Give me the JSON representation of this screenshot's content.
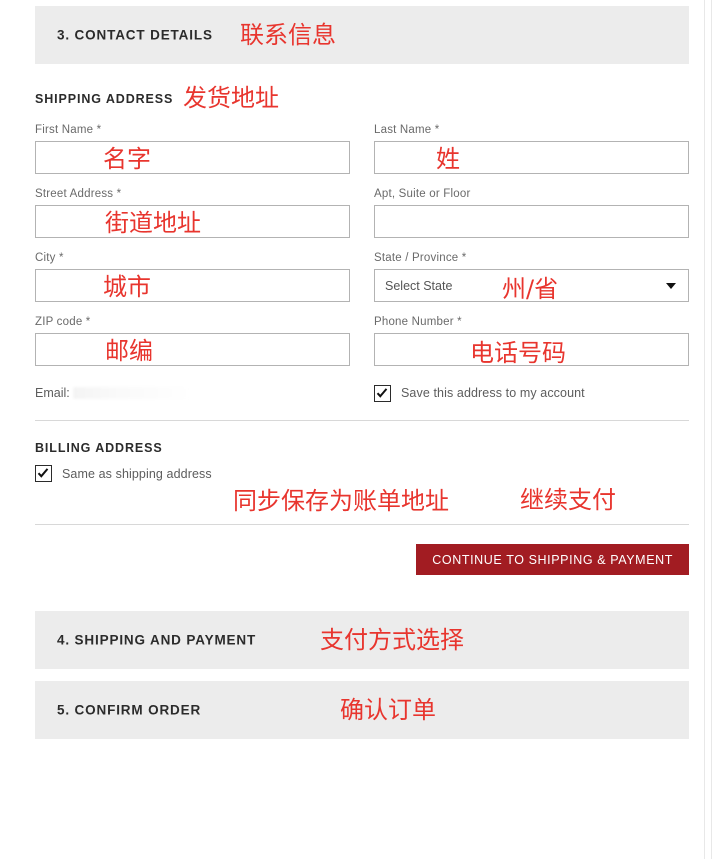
{
  "sections": [
    {
      "id": "contact",
      "number_title": "3. CONTACT DETAILS",
      "annotation": "联系信息"
    },
    {
      "id": "shipping_payment",
      "number_title": "4. SHIPPING AND PAYMENT",
      "annotation": "支付方式选择"
    },
    {
      "id": "confirm",
      "number_title": "5. CONFIRM ORDER",
      "annotation": "确认订单"
    }
  ],
  "shipping": {
    "heading": "SHIPPING ADDRESS",
    "heading_annotation": "发货地址",
    "fields": [
      {
        "label": "First Name *",
        "value": "",
        "placeholder": "",
        "annotation": "名字",
        "type": "text"
      },
      {
        "label": "Last Name *",
        "value": "",
        "placeholder": "",
        "annotation": "姓",
        "type": "text"
      },
      {
        "label": "Street Address *",
        "value": "",
        "placeholder": "",
        "annotation": "街道地址",
        "type": "text"
      },
      {
        "label": "Apt, Suite or Floor",
        "value": "",
        "placeholder": "",
        "annotation": "",
        "type": "text"
      },
      {
        "label": "City *",
        "value": "",
        "placeholder": "",
        "annotation": "城市",
        "type": "text"
      },
      {
        "label": "State / Province *",
        "value": "Select State",
        "placeholder": "",
        "annotation": "州/省",
        "type": "select"
      },
      {
        "label": "ZIP code *",
        "value": "",
        "placeholder": "",
        "annotation": "邮编",
        "type": "text"
      },
      {
        "label": "Phone Number *",
        "value": "",
        "placeholder": "",
        "annotation": "电话号码",
        "type": "text"
      }
    ],
    "email_label": "Email:",
    "email_value": "",
    "save_address": {
      "label": "Save this address to my account",
      "checked": true
    }
  },
  "billing": {
    "heading": "BILLING ADDRESS",
    "same_as_shipping": {
      "label": "Same as shipping address",
      "checked": true
    },
    "annotation": "同步保存为账单地址"
  },
  "continue_button": {
    "label": "CONTINUE TO SHIPPING & PAYMENT",
    "annotation": "继续支付",
    "color": "#a21c22"
  },
  "colors": {
    "annotation_red": "#e8352e",
    "section_bar_bg": "#ececec",
    "button_red": "#a21c22",
    "input_border": "#b3b3b3",
    "label_gray": "#6a6a6a"
  }
}
